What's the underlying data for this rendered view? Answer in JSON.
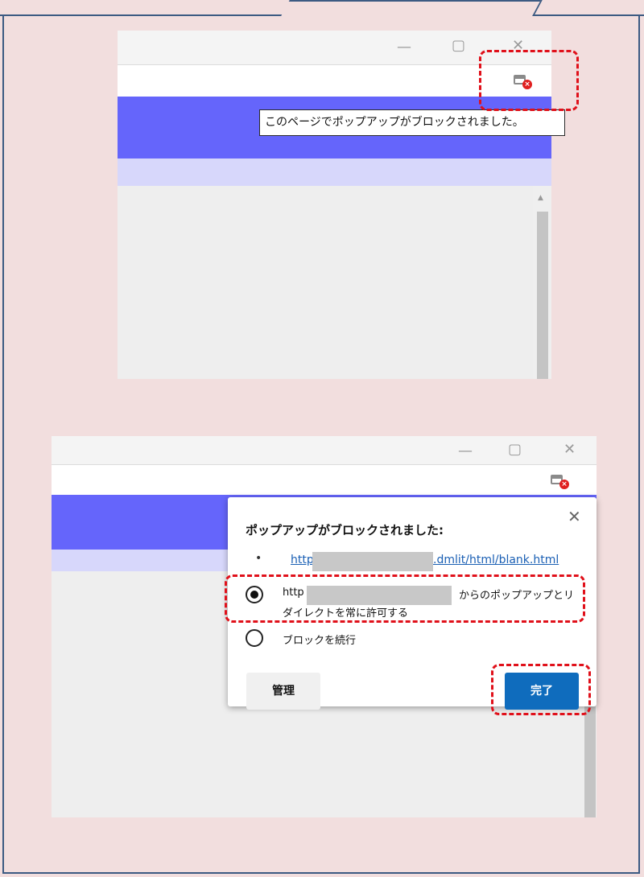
{
  "screenshot1": {
    "window_controls": [
      "—",
      "▢",
      "✕"
    ],
    "blocked_icon": "popup-blocked-icon",
    "tooltip": "このページでポップアップがブロックされました。",
    "scroll_up": "▲"
  },
  "screenshot2": {
    "window_controls": [
      "—",
      "▢",
      "✕"
    ],
    "blocked_icon": "popup-blocked-icon",
    "popup": {
      "title": "ポップアップがブロックされました:",
      "close": "✕",
      "bullet": "•",
      "link_start": "http",
      "link_end": ".dmlit/html/blank.html",
      "option_allow_start": "http",
      "option_allow_end": "からのポップアップとリ",
      "option_allow_line2": "ダイレクトを常に許可する",
      "option_block": "ブロックを続行",
      "manage_button": "管理",
      "done_button": "完了"
    }
  },
  "colors": {
    "highlight": "#e0101a",
    "page_band": "#6565fb",
    "done_button": "#0f6cbd"
  }
}
